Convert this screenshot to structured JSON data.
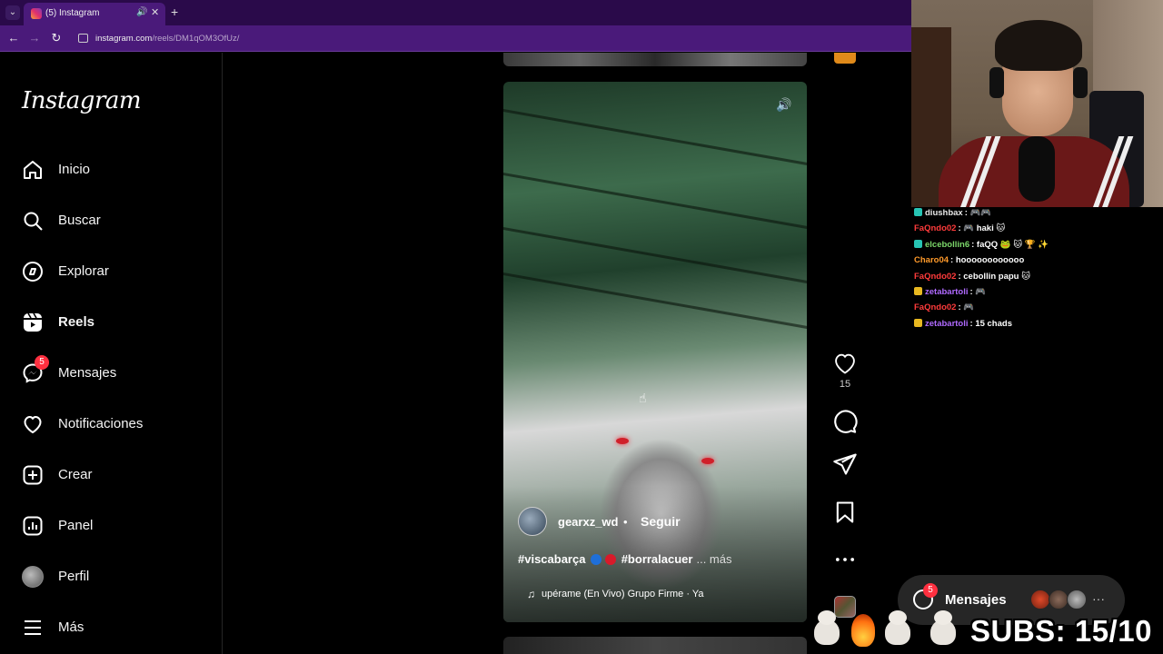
{
  "browser": {
    "tab_title": "(5) Instagram",
    "url_host": "instagram.com",
    "url_path": "/reels/DM1qOM3OfUz/"
  },
  "sidebar": {
    "logo": "Instagram",
    "items": [
      {
        "label": "Inicio",
        "icon": "home-icon"
      },
      {
        "label": "Buscar",
        "icon": "search-icon"
      },
      {
        "label": "Explorar",
        "icon": "compass-icon"
      },
      {
        "label": "Reels",
        "icon": "reels-icon",
        "active": true
      },
      {
        "label": "Mensajes",
        "icon": "messenger-icon",
        "badge": "5"
      },
      {
        "label": "Notificaciones",
        "icon": "heart-icon"
      },
      {
        "label": "Crear",
        "icon": "plus-square-icon"
      },
      {
        "label": "Panel",
        "icon": "chart-icon"
      },
      {
        "label": "Perfil",
        "icon": "avatar"
      },
      {
        "label": "Más",
        "icon": "menu-icon"
      }
    ]
  },
  "reel": {
    "username": "gearxz_wd",
    "separator": "•",
    "follow_label": "Seguir",
    "caption": "#viscabarça",
    "caption2": "#borralacuer",
    "more_label": "... más",
    "music": "upérame (En Vivo)   Grupo Firme · Ya",
    "likes": "15"
  },
  "chat": [
    {
      "user": "diushbax",
      "text": ": 🎮🎮",
      "color": "#e8e8e8",
      "badge": "#27c4b4"
    },
    {
      "user": "FaQndo02",
      "text": ": 🎮 haki 🐱",
      "color": "#ff3b3b",
      "badge": ""
    },
    {
      "user": "elcebollin6",
      "text": ": faQQ 🐸 🐱 🏆 ✨",
      "color": "#7cd86a",
      "badge": "#27c4b4"
    },
    {
      "user": "Charo04",
      "text": ": hoooooooooooo",
      "color": "#ff9a2a",
      "badge": ""
    },
    {
      "user": "FaQndo02",
      "text": ": cebollin papu 🐱",
      "color": "#ff3b3b",
      "badge": ""
    },
    {
      "user": "zetabartoli",
      "text": ": 🎮",
      "color": "#b06aff",
      "badge": "#e8b820"
    },
    {
      "user": "FaQndo02",
      "text": ": 🎮",
      "color": "#ff3b3b",
      "badge": ""
    },
    {
      "user": "zetabartoli",
      "text": ": 15 chads",
      "color": "#b06aff",
      "badge": "#e8b820"
    }
  ],
  "messages_pill": {
    "label": "Mensajes",
    "badge": "5",
    "more": "···"
  },
  "overlay": {
    "subs": "SUBS: 15/10"
  },
  "colors": {
    "tabbar": "#2a0a4a",
    "addrbar": "#4a1a7a",
    "badge": "#ff3040"
  }
}
